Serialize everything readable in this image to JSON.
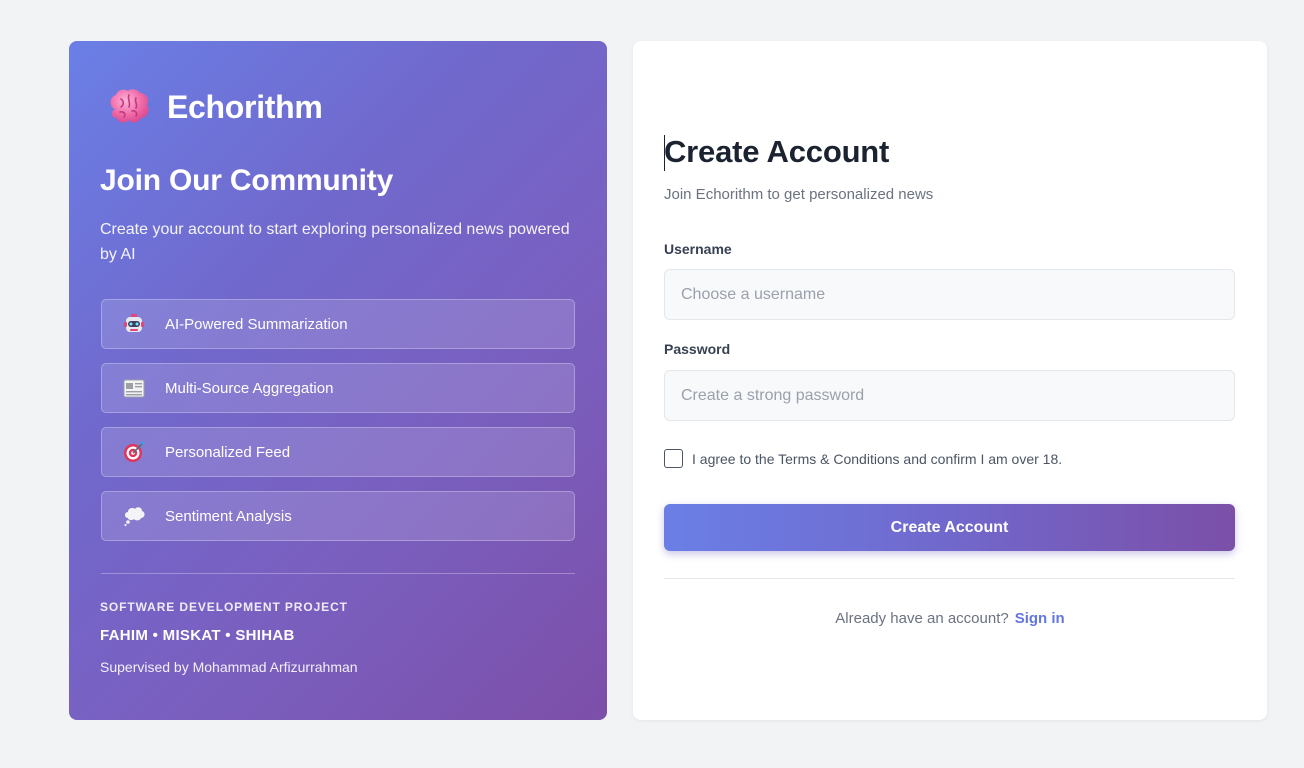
{
  "brand": {
    "name": "Echorithm",
    "icon": "brain-icon"
  },
  "left": {
    "title": "Join Our Community",
    "subtitle": "Create your account to start exploring personalized news powered by AI",
    "features": [
      {
        "icon": "robot-icon",
        "label": "AI-Powered Summarization"
      },
      {
        "icon": "newspaper-icon",
        "label": "Multi-Source Aggregation"
      },
      {
        "icon": "target-icon",
        "label": "Personalized Feed"
      },
      {
        "icon": "thought-bubble-icon",
        "label": "Sentiment Analysis"
      }
    ],
    "project_label": "SOFTWARE DEVELOPMENT PROJECT",
    "team": "FAHIM • MISKAT • SHIHAB",
    "supervisor": "Supervised by Mohammad Arfizurrahman"
  },
  "form": {
    "title": "Create Account",
    "subtitle": "Join Echorithm to get personalized news",
    "username": {
      "label": "Username",
      "placeholder": "Choose a username",
      "value": ""
    },
    "password": {
      "label": "Password",
      "placeholder": "Create a strong password",
      "value": ""
    },
    "agree_text": "I agree to the Terms & Conditions and confirm I am over 18.",
    "agree_checked": false,
    "submit_label": "Create Account",
    "signin_prompt": "Already have an account?",
    "signin_link": "Sign in"
  },
  "colors": {
    "gradient_start": "#6a7fe6",
    "gradient_end": "#7c4fa8",
    "link": "#6476e0",
    "heading": "#1b2230",
    "page_bg": "#f2f3f5"
  }
}
